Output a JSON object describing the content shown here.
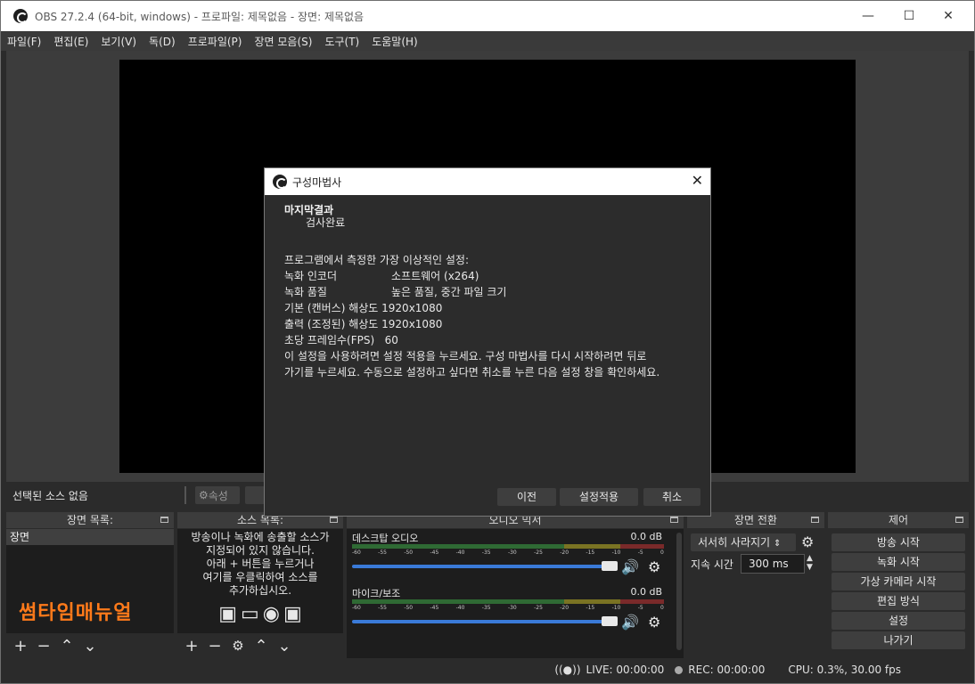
{
  "window": {
    "title": "OBS 27.2.4 (64-bit, windows) - 프로파일: 제목없음 - 장면: 제목없음",
    "minimize_icon": "minimize-icon",
    "maximize_icon": "maximize-icon",
    "close_icon": "close-icon"
  },
  "menu": {
    "items": [
      "파일(F)",
      "편집(E)",
      "보기(V)",
      "독(D)",
      "프로파일(P)",
      "장면 모음(S)",
      "도구(T)",
      "도움말(H)"
    ]
  },
  "source_bar": {
    "no_selection": "선택된 소스 없음",
    "properties_label": "속성"
  },
  "scenes": {
    "header": "장면 목록:",
    "items": [
      "장면"
    ],
    "watermark": "썸타임매뉴얼"
  },
  "sources": {
    "header": "소스 목록:",
    "help_lines": [
      "방송이나 녹화에 송출할 소스가",
      "지정되어 있지 않습니다.",
      "아래 + 버튼을 누르거나",
      "여기를 우클릭하여 소스를",
      "추가하십시오."
    ]
  },
  "mixer": {
    "header": "오디오 믹서",
    "ticks": [
      "-60",
      "-55",
      "-50",
      "-45",
      "-40",
      "-35",
      "-30",
      "-25",
      "-20",
      "-15",
      "-10",
      "-5",
      "0"
    ],
    "channels": [
      {
        "name": "데스크탑 오디오",
        "db": "0.0 dB",
        "volume": 1.0
      },
      {
        "name": "마이크/보조",
        "db": "0.0 dB",
        "volume": 1.0
      }
    ]
  },
  "transitions": {
    "header": "장면 전환",
    "selected": "서서히 사라지기",
    "duration_label": "지속 시간",
    "duration_value": "300 ms"
  },
  "controls": {
    "header": "제어",
    "buttons": [
      "방송 시작",
      "녹화 시작",
      "가상 카메라 시작",
      "편집 방식",
      "설정",
      "나가기"
    ]
  },
  "status": {
    "live": "LIVE: 00:00:00",
    "rec": "REC: 00:00:00",
    "cpu": "CPU: 0.3%, 30.00 fps"
  },
  "dialog": {
    "title": "구성마법사",
    "heading": "마지막결과",
    "subheading": "검사완료",
    "intro": "프로그램에서 측정한 가장 이상적인 설정:",
    "settings": [
      {
        "key": "녹화 인코더",
        "value": "소프트웨어 (x264)"
      },
      {
        "key": "녹화 품질",
        "value": "높은 품질, 중간 파일 크기"
      },
      {
        "key": "기본 (캔버스) 해상도",
        "value": "1920x1080"
      },
      {
        "key": "출력 (조정된) 해상도",
        "value": "1920x1080"
      },
      {
        "key": "초당 프레임수(FPS)",
        "value": "60"
      }
    ],
    "note_line1": "이 설정을 사용하려면 설정 적용을 누르세요. 구성 마법사를 다시 시작하려면 뒤로",
    "note_line2": "가기를 누르세요. 수동으로 설정하고 싶다면 취소를 누른 다음 설정 창을 확인하세요.",
    "buttons": {
      "back": "이전",
      "apply": "설정적용",
      "cancel": "취소"
    }
  }
}
